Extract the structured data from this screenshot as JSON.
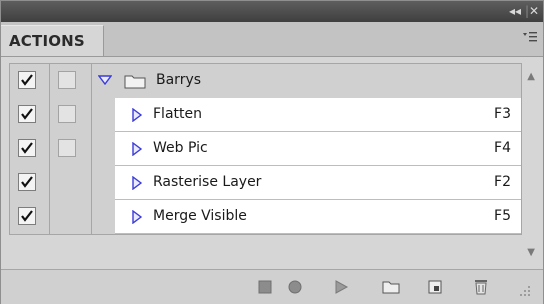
{
  "title_bar": {
    "collapse_label": "◂◂",
    "close_label": "✕"
  },
  "tab": {
    "label": "ACTIONS"
  },
  "panel_menu_icon": "panel-menu-icon",
  "action_set": {
    "name": "Barrys",
    "included": true
  },
  "actions": [
    {
      "name": "Flatten",
      "key": "F3",
      "included": true
    },
    {
      "name": "Web Pic",
      "key": "F4",
      "included": true
    },
    {
      "name": "Rasterise Layer",
      "key": "F2",
      "included": true
    },
    {
      "name": "Merge Visible",
      "key": "F5",
      "included": true
    }
  ],
  "toolbar": [
    {
      "icon": "stop-icon"
    },
    {
      "icon": "record-icon"
    },
    {
      "icon": "play-icon"
    },
    {
      "icon": "new-set-folder-icon"
    },
    {
      "icon": "new-action-icon"
    },
    {
      "icon": "delete-trash-icon"
    }
  ],
  "colors": {
    "tab_text": "#2a2a2a",
    "expand_triangle": "#3b3bd8",
    "row_bg": "#ffffff"
  }
}
